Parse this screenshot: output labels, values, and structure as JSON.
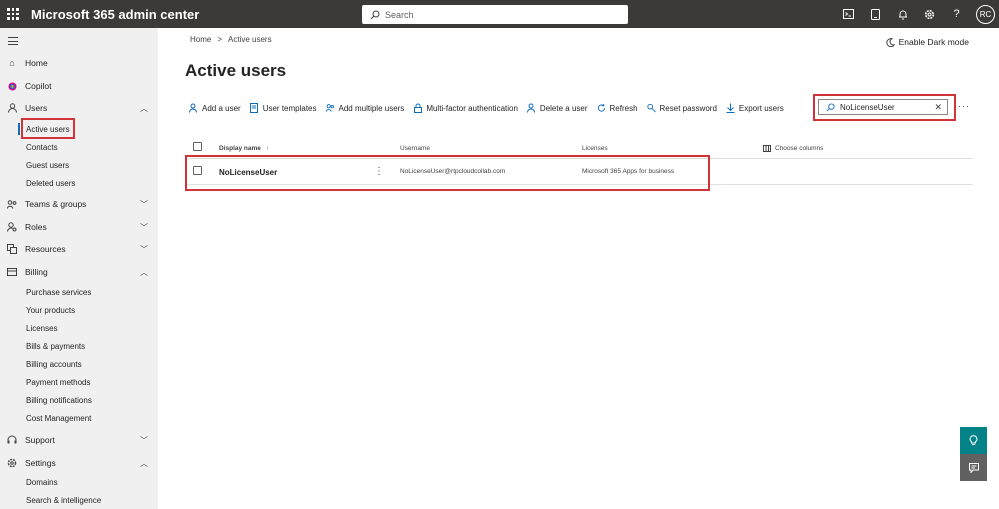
{
  "app": {
    "title": "Microsoft 365 admin center"
  },
  "top_search": {
    "placeholder": "Search"
  },
  "top_icons": [
    "terminal-icon",
    "mobile-icon",
    "bell-icon",
    "gear-icon",
    "help-icon"
  ],
  "user": {
    "initials": "RC"
  },
  "sidebar": {
    "items": [
      {
        "label": "Home",
        "icon": "home-icon"
      },
      {
        "label": "Copilot",
        "icon": "copilot-icon"
      },
      {
        "label": "Users",
        "icon": "user-icon"
      },
      {
        "label": "Teams & groups",
        "icon": "teams-icon"
      },
      {
        "label": "Roles",
        "icon": "roles-icon"
      },
      {
        "label": "Resources",
        "icon": "resources-icon"
      },
      {
        "label": "Billing",
        "icon": "billing-icon"
      },
      {
        "label": "Support",
        "icon": "headset-icon"
      },
      {
        "label": "Settings",
        "icon": "gear-icon"
      }
    ],
    "users_sub": [
      "Active users",
      "Contacts",
      "Guest users",
      "Deleted users"
    ],
    "billing_sub": [
      "Purchase services",
      "Your products",
      "Licenses",
      "Bills & payments",
      "Billing accounts",
      "Payment methods",
      "Billing notifications",
      "Cost Management"
    ],
    "settings_sub": [
      "Domains",
      "Search & intelligence"
    ]
  },
  "breadcrumb": {
    "home": "Home",
    "sep": ">",
    "current": "Active users"
  },
  "dark_mode": {
    "label": "Enable Dark mode"
  },
  "page": {
    "title": "Active users"
  },
  "toolbar": {
    "add_user": "Add a user",
    "user_templates": "User templates",
    "add_multiple": "Add multiple users",
    "mfa": "Multi-factor authentication",
    "delete_user": "Delete a user",
    "refresh": "Refresh",
    "reset_password": "Reset password",
    "export_users": "Export users"
  },
  "filter": {
    "value": "NoLicenseUser"
  },
  "table": {
    "headers": {
      "display_name": "Display name",
      "sort_arrow": "↑",
      "username": "Username",
      "licenses": "Licenses",
      "choose_columns": "Choose columns"
    },
    "rows": [
      {
        "display_name": "NoLicenseUser",
        "username": "NoLicenseUser@rtpcloudcollab.com",
        "licenses": "Microsoft 365 Apps for business"
      }
    ]
  },
  "colors": {
    "topbar": "#3b3a39",
    "accent": "#0f6cbd",
    "highlight": "#d13438",
    "fab": "#038387",
    "fab2": "#616161"
  }
}
